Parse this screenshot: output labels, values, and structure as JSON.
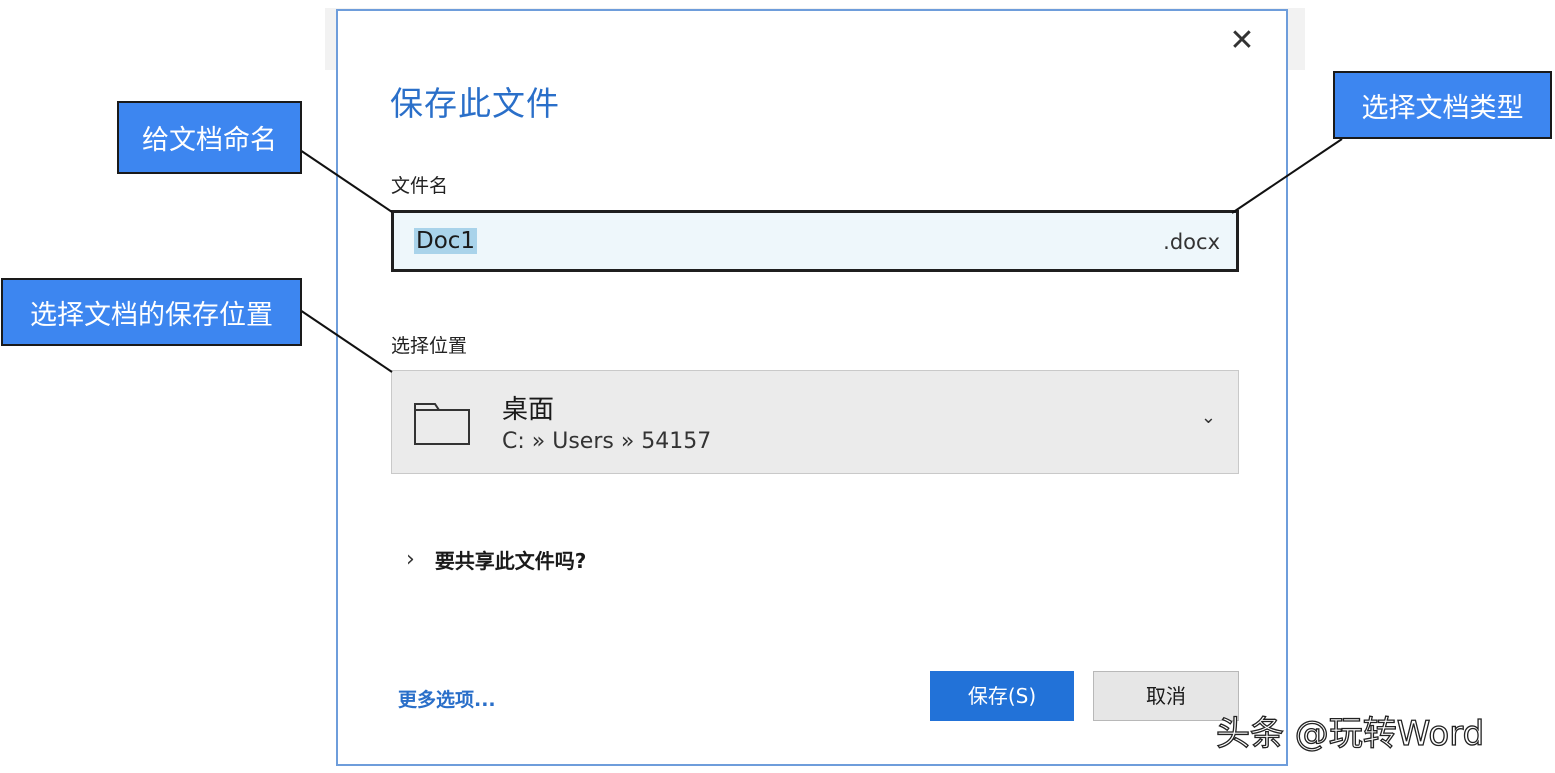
{
  "dialog": {
    "title": "保存此文件",
    "close_glyph": "✕",
    "filename": {
      "label": "文件名",
      "value": "Doc1",
      "extension": ".docx"
    },
    "location": {
      "label": "选择位置",
      "name": "桌面",
      "path": "C: » Users » 54157",
      "icon": "folder-icon",
      "chevron": "⌄"
    },
    "share": {
      "chevron": "›",
      "label": "要共享此文件吗?"
    },
    "more_options": "更多选项...",
    "save_button": "保存(S)",
    "cancel_button": "取消"
  },
  "callouts": {
    "name_doc": "给文档命名",
    "doc_type": "选择文档类型",
    "save_location": "选择文档的保存位置"
  },
  "watermark": "头条 @玩转Word",
  "colors": {
    "accent": "#2272d8",
    "title_blue": "#2a6fc9",
    "callout_bg": "#3d86f0",
    "dialog_border": "#6e9ddb"
  }
}
